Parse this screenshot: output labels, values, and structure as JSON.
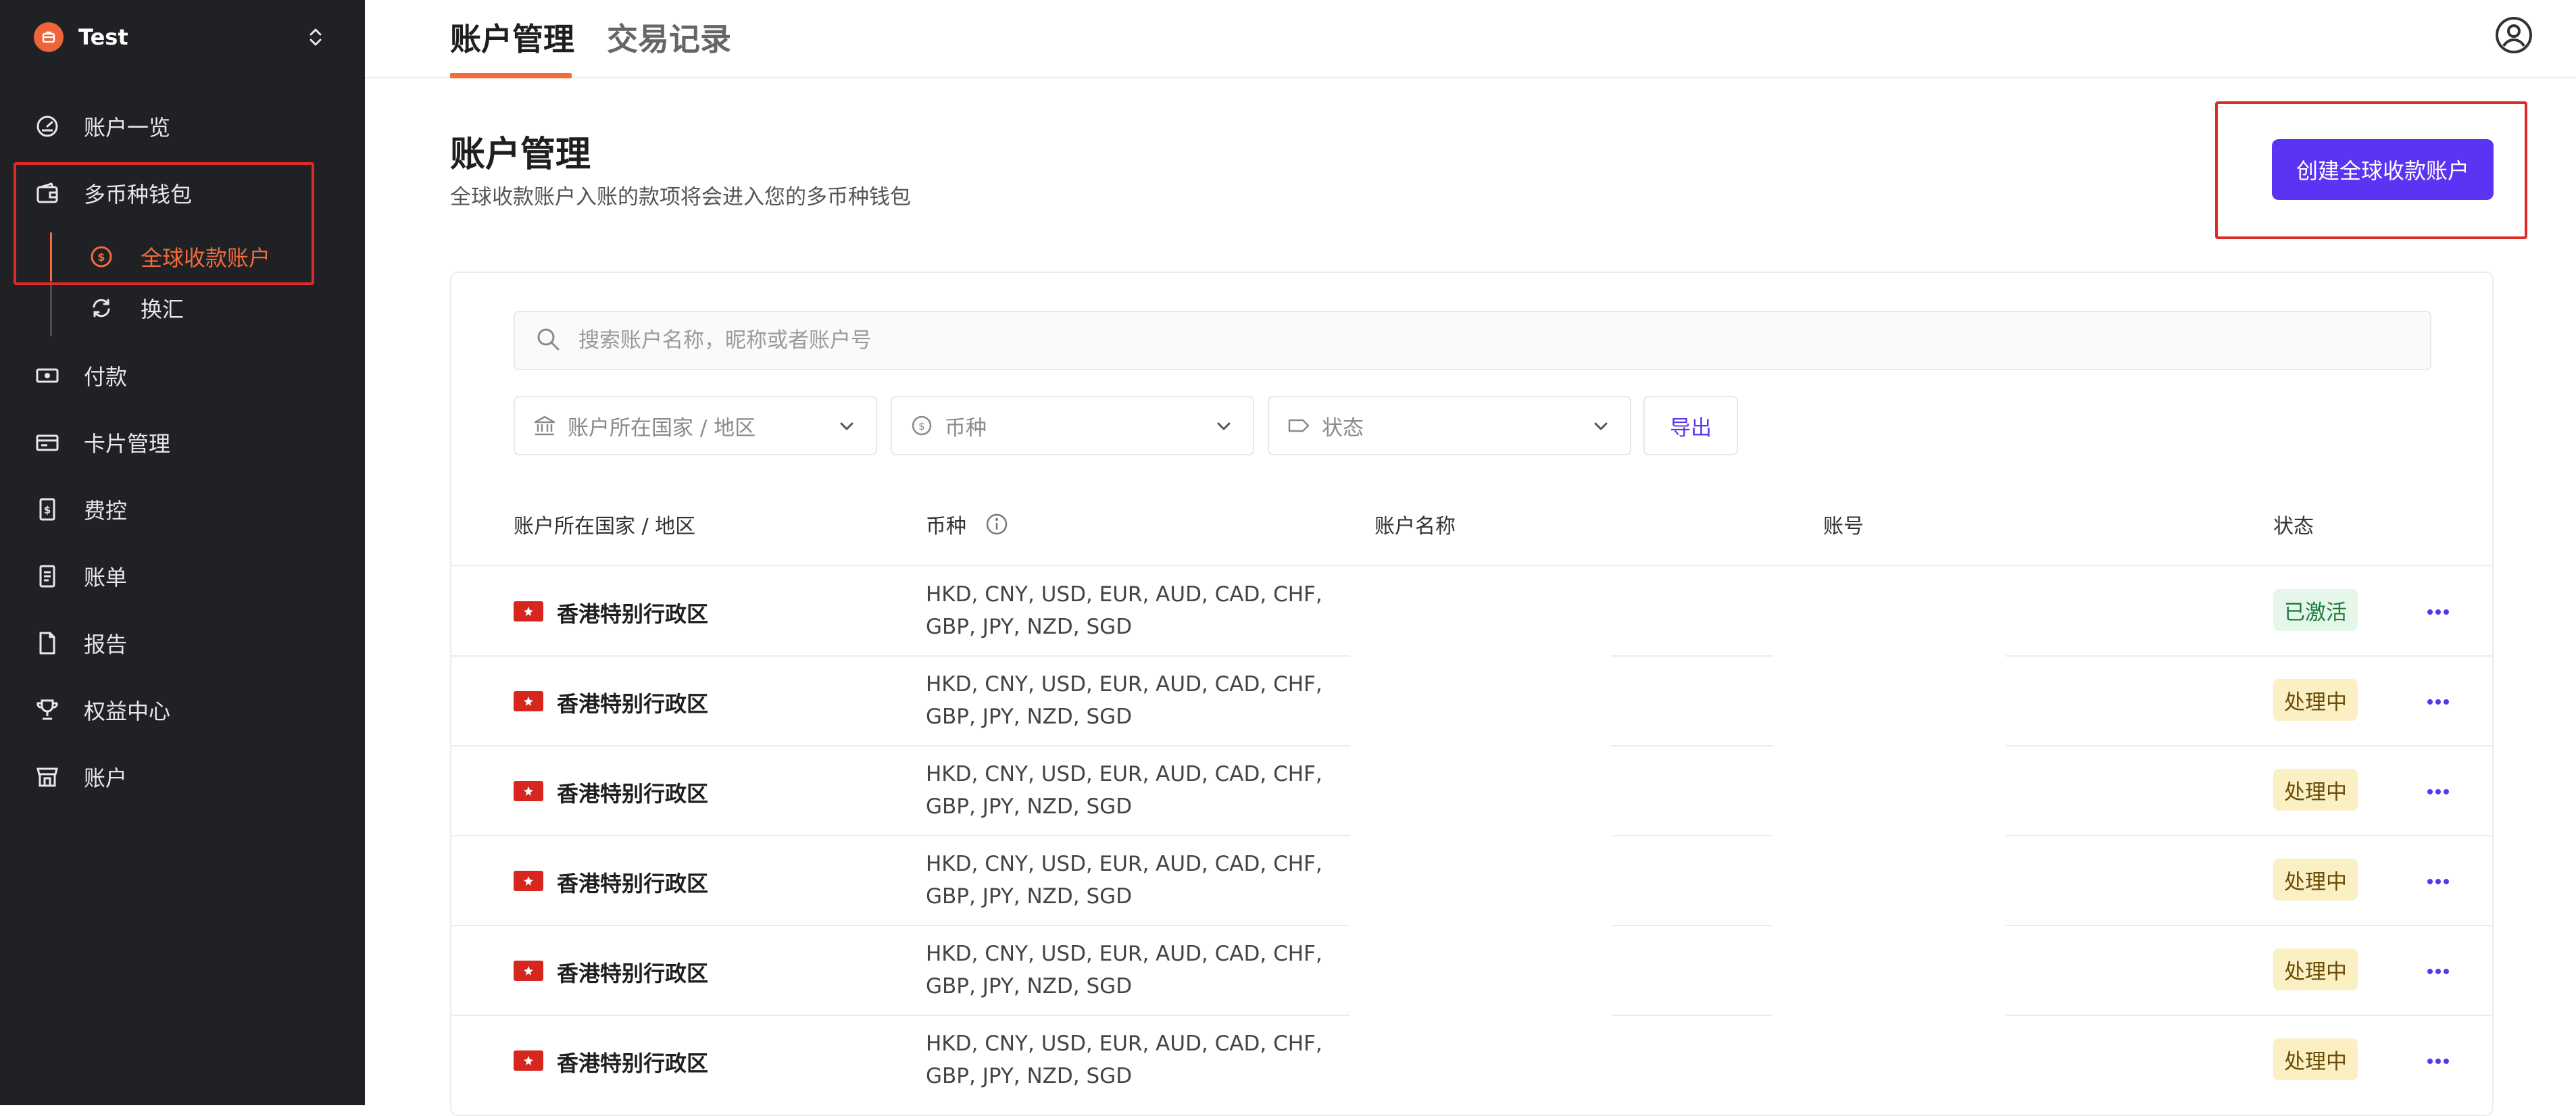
{
  "sidebar": {
    "brand": "Test",
    "items": [
      {
        "label": "账户一览",
        "icon": "dashboard-icon"
      },
      {
        "label": "多币种钱包",
        "icon": "wallet-icon"
      },
      {
        "label": "付款",
        "icon": "money-icon"
      },
      {
        "label": "卡片管理",
        "icon": "card-icon"
      },
      {
        "label": "费控",
        "icon": "expense-icon"
      },
      {
        "label": "账单",
        "icon": "bill-icon"
      },
      {
        "label": "报告",
        "icon": "report-icon"
      },
      {
        "label": "权益中心",
        "icon": "trophy-icon"
      },
      {
        "label": "账户",
        "icon": "store-icon"
      }
    ],
    "subitems": [
      {
        "label": "全球收款账户",
        "icon": "dollar-coin-icon",
        "active": true
      },
      {
        "label": "换汇",
        "icon": "exchange-icon",
        "active": false
      }
    ]
  },
  "tabs": [
    "账户管理",
    "交易记录"
  ],
  "header": {
    "title": "账户管理",
    "subtitle": "全球收款账户入账的款项将会进入您的多币种钱包",
    "create_button": "创建全球收款账户"
  },
  "search": {
    "placeholder": "搜索账户名称，昵称或者账户号"
  },
  "filters": {
    "country": "账户所在国家 / 地区",
    "currency": "币种",
    "status": "状态",
    "export": "导出"
  },
  "table": {
    "columns": [
      "账户所在国家 / 地区",
      "币种",
      "账户名称",
      "账号",
      "状态"
    ],
    "rows": [
      {
        "region": "香港特别行政区",
        "currencies_1": "HKD, CNY, USD, EUR, AUD, CAD, CHF,",
        "currencies_2": "GBP, JPY, NZD, SGD",
        "status": "已激活",
        "status_type": "active"
      },
      {
        "region": "香港特别行政区",
        "currencies_1": "HKD, CNY, USD, EUR, AUD, CAD, CHF,",
        "currencies_2": "GBP, JPY, NZD, SGD",
        "status": "处理中",
        "status_type": "processing"
      },
      {
        "region": "香港特别行政区",
        "currencies_1": "HKD, CNY, USD, EUR, AUD, CAD, CHF,",
        "currencies_2": "GBP, JPY, NZD, SGD",
        "status": "处理中",
        "status_type": "processing"
      },
      {
        "region": "香港特别行政区",
        "currencies_1": "HKD, CNY, USD, EUR, AUD, CAD, CHF,",
        "currencies_2": "GBP, JPY, NZD, SGD",
        "status": "处理中",
        "status_type": "processing"
      },
      {
        "region": "香港特别行政区",
        "currencies_1": "HKD, CNY, USD, EUR, AUD, CAD, CHF,",
        "currencies_2": "GBP, JPY, NZD, SGD",
        "status": "处理中",
        "status_type": "processing"
      },
      {
        "region": "香港特别行政区",
        "currencies_1": "HKD, CNY, USD, EUR, AUD, CAD, CHF,",
        "currencies_2": "GBP, JPY, NZD, SGD",
        "status": "处理中",
        "status_type": "processing"
      }
    ]
  },
  "colors": {
    "accent": "#f26b3a",
    "primary": "#5b33f2",
    "highlight": "#e02a2a"
  }
}
